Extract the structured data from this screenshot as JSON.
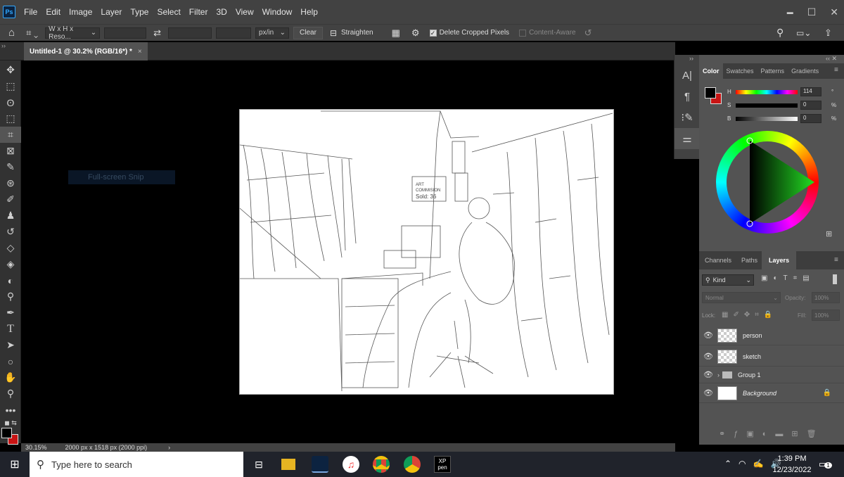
{
  "app": {
    "logo": "Ps"
  },
  "menu": [
    "File",
    "Edit",
    "Image",
    "Layer",
    "Type",
    "Select",
    "Filter",
    "3D",
    "View",
    "Window",
    "Help"
  ],
  "window_controls": {
    "minimize": "▬",
    "maximize": "☐",
    "close": "✕"
  },
  "options_bar": {
    "ratio_select": "W x H x Reso...",
    "unit_select": "px/in",
    "clear_label": "Clear",
    "straighten_label": "Straighten",
    "delete_cropped_label": "Delete Cropped Pixels",
    "content_aware_label": "Content-Aware"
  },
  "document_tab": {
    "title": "Untitled-1 @ 30.2% (RGB/16*) *",
    "close": "×"
  },
  "snip_tooltip": "Full-screen Snip",
  "status": {
    "zoom": "30.15%",
    "doc_info": "2000 px x 1518 px (2000 ppi)"
  },
  "color_panel": {
    "tabs": [
      "Color",
      "Swatches",
      "Patterns",
      "Gradients"
    ],
    "h_label": "H",
    "s_label": "S",
    "b_label": "B",
    "h_value": "114",
    "s_value": "0",
    "b_value": "0",
    "h_unit": "°",
    "s_unit": "%",
    "b_unit": "%",
    "foreground": "#000000",
    "background": "#cc1111"
  },
  "layers_panel": {
    "tabs": [
      "Channels",
      "Paths",
      "Layers"
    ],
    "kind_label": "Kind",
    "blend_mode": "Normal",
    "opacity_label": "Opacity:",
    "opacity_value": "100%",
    "lock_label": "Lock:",
    "fill_label": "Fill:",
    "fill_value": "100%",
    "layers": [
      {
        "name": "person"
      },
      {
        "name": "sketch"
      },
      {
        "name": "Group 1"
      },
      {
        "name": "Background"
      }
    ]
  },
  "taskbar": {
    "search_placeholder": "Type here to search",
    "time": "1:39 PM",
    "date": "12/23/2022",
    "xp_label_top": "XP",
    "xp_label_bottom": "pen",
    "notifications": "1"
  }
}
